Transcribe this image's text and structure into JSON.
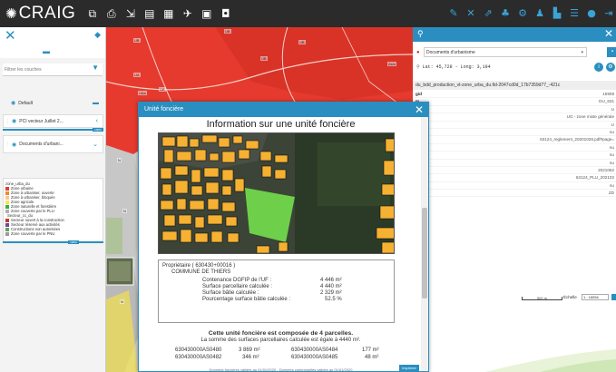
{
  "app": {
    "name": "CRAIG"
  },
  "left_panel": {
    "filter_placeholder": "Filtrer les couches",
    "layers": [
      {
        "label": "Default"
      },
      {
        "label": "PCI vecteur Juillet 2..."
      },
      {
        "label": "Documents d'urbani..."
      }
    ],
    "opacity_value_label": "100%"
  },
  "legend": {
    "title": "zone_urba_du",
    "items": [
      {
        "label": "Zone urbaine",
        "color": "#e63a2e"
      },
      {
        "label": "Zone à urbaniser, ouverte",
        "color": "#f08a2b"
      },
      {
        "label": "Zone à urbaniser, bloquée",
        "color": "#f7c69a"
      },
      {
        "label": "Zone agricole",
        "color": "#f5e84a"
      },
      {
        "label": "Zone naturelle et forestière",
        "color": "#3cae3c"
      },
      {
        "label": "Zone couverte par le PLU",
        "color": "#b0b0b0"
      },
      {
        "label": "Secteur_cc_du",
        "color": ""
      },
      {
        "label": "Secteur ouvert à la construction",
        "color": "#c0392b"
      },
      {
        "label": "Secteur réservé aux activités",
        "color": "#7b3fa0"
      },
      {
        "label": "Constructions non autorisées",
        "color": "#5da55d"
      },
      {
        "label": "Zone couverte par le PNU",
        "color": "#9b9b9b"
      }
    ]
  },
  "map": {
    "labels": [
      "UB",
      "UB",
      "UB",
      "UB",
      "UA",
      "UA",
      "AUa",
      "UAa",
      "UA",
      "N",
      "N",
      "N"
    ]
  },
  "right_panel": {
    "layer_select": "Documents d'urbanisme",
    "coordinates": "Lat: 45,728 - Long: 3,194",
    "feature_id": "du_bdd_production_vt-zone_urba_du.fid-2047cd0d_17b7359d77_-421c",
    "attributes": [
      {
        "key": "gid",
        "value": "15908"
      },
      {
        "key": "m",
        "value": "DU_631"
      },
      {
        "key": "",
        "value": "U"
      },
      {
        "key": "g",
        "value": "UG - zone mixte générale"
      },
      {
        "key": "me",
        "value": "U"
      },
      {
        "key": "mi",
        "value": "nu"
      },
      {
        "key": "",
        "value": "63124_reglement_20201028.pdf#page="
      },
      {
        "key": "",
        "value": "nu"
      },
      {
        "key": "",
        "value": "nu"
      },
      {
        "key": "ro",
        "value": "nu"
      },
      {
        "key": "d",
        "value": "2021062"
      },
      {
        "key": "",
        "value": "63124_PLU_202102"
      },
      {
        "key": "",
        "value": "nu"
      },
      {
        "key": "one",
        "value": "ZD"
      }
    ],
    "scale_label": "500 m",
    "echelle_label": "Échelle",
    "echelle_value": "1 : 18056"
  },
  "modal": {
    "window_title": "Unité foncière",
    "report_title": "Information sur une unité foncière",
    "owner": "Propriétaire ( 630430+00016 )",
    "commune": "COMMUNE DE THIERS",
    "stats": [
      {
        "label": "Contenance DGFIP de l'UF :",
        "value": "4 446 m²"
      },
      {
        "label": "Surface parcellaire calculée :",
        "value": "4 440 m²"
      },
      {
        "label": "Surface bâtie calculée :",
        "value": "2 329 m²"
      },
      {
        "label": "Pourcentage surface bâtie calculée :",
        "value": "52.5 %"
      }
    ],
    "parcels_title": "Cette unité foncière est composée de 4 parcelles.",
    "parcels_sub": "La somme des surfaces parcellaires calculée est égale à 4440 m².",
    "parcels": [
      {
        "id": "630430000AS0480",
        "area": "3 869 m²"
      },
      {
        "id": "630430000AS0484",
        "area": "177 m²"
      },
      {
        "id": "630430000AS0482",
        "area": "346 m²"
      },
      {
        "id": "630430000AS0485",
        "area": "48 m²"
      }
    ],
    "disclaimer": "Données foncières valides au 01/01/2020 - Données contextuelles valides au 01/01/2020",
    "print_label": "Imprimer"
  },
  "colors": {
    "accent": "#2a8fc0",
    "topbar": "#2b2b2b",
    "zone_urbaine": "#e63a2e",
    "zone_agricole": "#f5e84a",
    "zone_naturelle": "#3cae3c",
    "building": "#f6b133"
  }
}
